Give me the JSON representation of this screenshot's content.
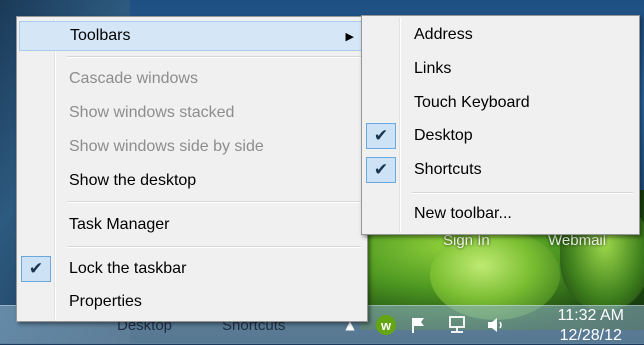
{
  "context_menu": {
    "toolbars_label": "Toolbars",
    "cascade_label": "Cascade windows",
    "stacked_label": "Show windows stacked",
    "side_by_side_label": "Show windows side by side",
    "show_desktop_label": "Show the desktop",
    "task_manager_label": "Task Manager",
    "lock_taskbar_label": "Lock the taskbar",
    "lock_taskbar_checked": true,
    "properties_label": "Properties"
  },
  "toolbars_submenu": {
    "address_label": "Address",
    "links_label": "Links",
    "touch_keyboard_label": "Touch Keyboard",
    "desktop_label": "Desktop",
    "desktop_checked": true,
    "shortcuts_label": "Shortcuts",
    "shortcuts_checked": true,
    "new_toolbar_label": "New toolbar..."
  },
  "desktop_icons": {
    "sign_in_label": "Sign In",
    "webmail_label": "Webmail"
  },
  "taskbar": {
    "desktop_toolbar_label": "Desktop",
    "shortcuts_toolbar_label": "Shortcuts",
    "tray_w_glyph": "w",
    "clock_time": "11:32 AM",
    "clock_date": "12/28/12"
  },
  "icons": {
    "checkmark": "checkmark-icon",
    "submenu_arrow": "chevron-right-icon",
    "tray_expand": "chevron-up-icon",
    "flag": "action-center-flag-icon",
    "network": "network-icon",
    "volume": "speaker-icon"
  },
  "colors": {
    "menu_background": "#f0f0f0",
    "highlight_background": "#d5e6f7",
    "disabled_text": "#8d8d8d",
    "check_background": "#cde2f5"
  }
}
